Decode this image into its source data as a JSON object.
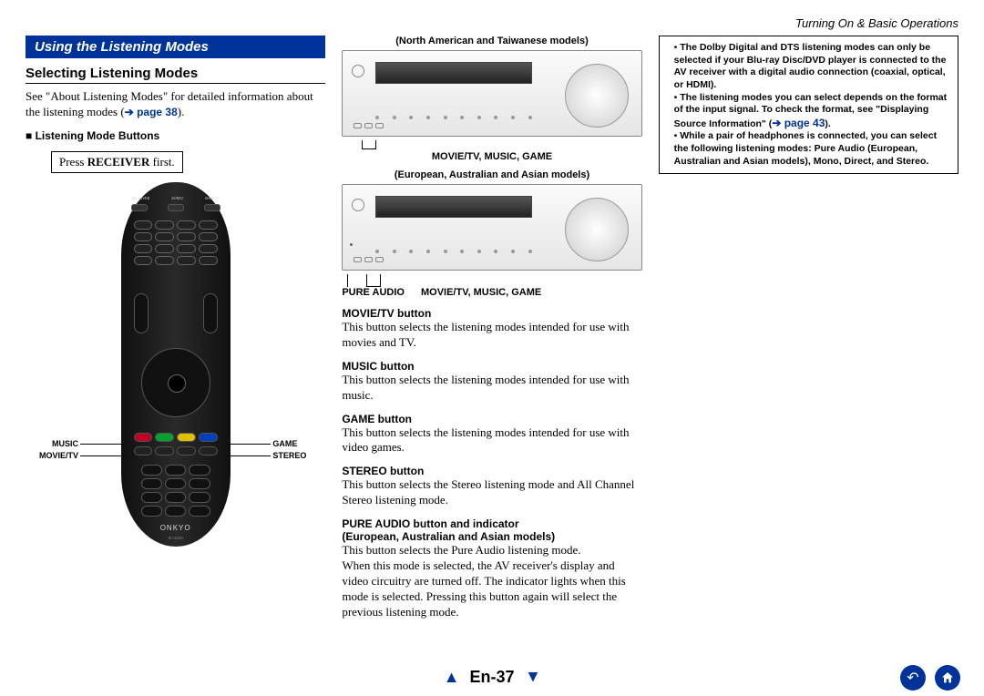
{
  "chapter": "Turning On & Basic Operations",
  "section_title": "Using the Listening Modes",
  "subsection": "Selecting Listening Modes",
  "intro": "See \"About Listening Modes\" for detailed information about the listening modes (",
  "intro_link_arrow": "➔",
  "intro_link": "page 38",
  "intro_close": ").",
  "listening_mode_buttons_label": "■ Listening Mode Buttons",
  "callout_pre": "Press ",
  "callout_bold": "RECEIVER",
  "callout_post": " first.",
  "remote_labels": {
    "music": "MUSIC",
    "movie_tv": "MOVIE/TV",
    "game": "GAME",
    "stereo": "STEREO"
  },
  "remote_top": {
    "receiver": "RECEIVER",
    "zone2": "ZONE2",
    "source": "SOURCE"
  },
  "remote_logo": "ONKYO",
  "remote_model": "RC-834M",
  "panel_na_label": "(North American and Taiwanese models)",
  "panel_na_caption": "MOVIE/TV, MUSIC, GAME",
  "panel_eu_label": "(European, Australian and Asian models)",
  "panel_eu_caption_left": "PURE AUDIO",
  "panel_eu_caption_right": "MOVIE/TV, MUSIC, GAME",
  "buttons": [
    {
      "head": "MOVIE/TV button",
      "text": "This button selects the listening modes intended for use with movies and TV."
    },
    {
      "head": "MUSIC button",
      "text": "This button selects the listening modes intended for use with music."
    },
    {
      "head": "GAME button",
      "text": "This button selects the listening modes intended for use with video games."
    },
    {
      "head": "STEREO button",
      "text": "This button selects the Stereo listening mode and All Channel Stereo listening mode."
    }
  ],
  "pure_audio_head": "PURE AUDIO button and indicator",
  "pure_audio_sub": "(European, Australian and Asian models)",
  "pure_audio_p1": "This button selects the Pure Audio listening mode.",
  "pure_audio_p2": "When this mode is selected, the AV receiver's display and video circuitry are turned off. The indicator lights when this mode is selected. Pressing this button again will select the previous listening mode.",
  "notes": [
    "The Dolby Digital and DTS listening modes can only be selected if your Blu-ray Disc/DVD player is connected to the AV receiver with a digital audio connection (coaxial, optical, or HDMI).",
    "The listening modes you can select depends on the format of the input signal. To check the format, see \"Displaying Source Information\" (",
    "While a pair of headphones is connected, you can select the following listening modes: Pure Audio (European, Australian and Asian models), Mono, Direct, and Stereo."
  ],
  "note2_link": "page 43",
  "note2_close": ").",
  "page_number": "En-37"
}
